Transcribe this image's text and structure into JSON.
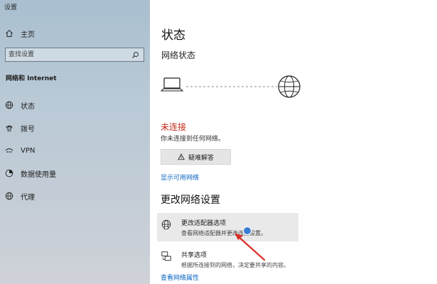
{
  "app": {
    "title": "设置"
  },
  "sidebar": {
    "home": "主页",
    "search_placeholder": "查找设置",
    "section": "网络和 Internet",
    "items": [
      {
        "label": "状态",
        "icon": "globe-icon"
      },
      {
        "label": "拨号",
        "icon": "phone-icon"
      },
      {
        "label": "VPN",
        "icon": "vpn-icon"
      },
      {
        "label": "数据使用量",
        "icon": "data-usage-icon"
      },
      {
        "label": "代理",
        "icon": "globe-icon"
      }
    ]
  },
  "main": {
    "title": "状态",
    "network_status_heading": "网络状态",
    "status": "未连接",
    "status_desc": "你未连接到任何网络。",
    "troubleshoot_label": "疑难解答",
    "show_networks_link": "显示可用网络",
    "change_settings_heading": "更改网络设置",
    "settings": [
      {
        "title": "更改适配器选项",
        "desc": "查看网络适配器并更改连接设置。",
        "icon": "adapter-icon"
      },
      {
        "title": "共享选项",
        "desc": "根据所连接到的网络，决定要共享的内容。",
        "icon": "sharing-icon"
      }
    ],
    "properties_link": "查看网络属性"
  },
  "colors": {
    "accent": "#0b66c2",
    "error": "#c42b1c",
    "annotation": "#d9302a"
  }
}
